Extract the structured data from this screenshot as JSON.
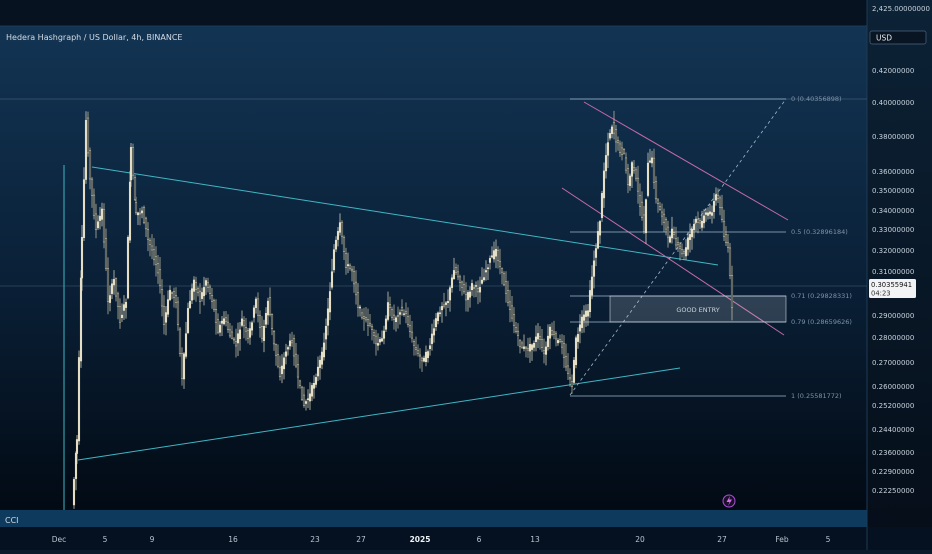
{
  "chart_data": {
    "type": "candlestick",
    "title": "Hedera Hashgraph / US Dollar, 4h, BINANCE",
    "currency": "USD",
    "price_scale": [
      {
        "label": "2,425.00000000",
        "value": 2425
      },
      {
        "label": "0.42000000",
        "value": 0.42
      },
      {
        "label": "0.40000000",
        "value": 0.4
      },
      {
        "label": "0.38000000",
        "value": 0.38
      },
      {
        "label": "0.36000000",
        "value": 0.36
      },
      {
        "label": "0.35000000",
        "value": 0.35
      },
      {
        "label": "0.34000000",
        "value": 0.34
      },
      {
        "label": "0.33000000",
        "value": 0.33
      },
      {
        "label": "0.32000000",
        "value": 0.32
      },
      {
        "label": "0.31000000",
        "value": 0.31
      },
      {
        "label": "0.29000000",
        "value": 0.29
      },
      {
        "label": "0.28000000",
        "value": 0.28
      },
      {
        "label": "0.27000000",
        "value": 0.27
      },
      {
        "label": "0.26000000",
        "value": 0.26
      },
      {
        "label": "0.25200000",
        "value": 0.252
      },
      {
        "label": "0.24400000",
        "value": 0.244
      },
      {
        "label": "0.23600000",
        "value": 0.236
      },
      {
        "label": "0.22900000",
        "value": 0.229
      },
      {
        "label": "0.22250000",
        "value": 0.2225
      }
    ],
    "last_price": "0.30355941",
    "countdown": "04:23",
    "x_ticks": [
      {
        "label": "Dec",
        "bold": false
      },
      {
        "label": "5",
        "bold": false
      },
      {
        "label": "9",
        "bold": false
      },
      {
        "label": "16",
        "bold": false
      },
      {
        "label": "23",
        "bold": false
      },
      {
        "label": "27",
        "bold": false
      },
      {
        "label": "2025",
        "bold": true
      },
      {
        "label": "6",
        "bold": false
      },
      {
        "label": "13",
        "bold": false
      },
      {
        "label": "20",
        "bold": false
      },
      {
        "label": "27",
        "bold": false
      },
      {
        "label": "Feb",
        "bold": false
      },
      {
        "label": "5",
        "bold": false
      }
    ],
    "fib_levels": [
      {
        "label": "0 (0.40356898)",
        "value": 0.40356898
      },
      {
        "label": "0.5 (0.32896184)",
        "value": 0.32896184
      },
      {
        "label": "0.71 (0.29828331)",
        "value": 0.29828331
      },
      {
        "label": "0.79 (0.28659626)",
        "value": 0.28659626
      },
      {
        "label": "1 (0.25581772)",
        "value": 0.25581772
      }
    ],
    "zone_label": "GOOD ENTRY",
    "indicator_label": "CCI",
    "colors": {
      "bull": "#e8e2c8",
      "bear": "#cfc6a6",
      "trendline": "#3fb7c4",
      "channel": "#c56aa8",
      "fib": "#8aa2b6",
      "zone": "#d9dee6",
      "background_top": "#123453",
      "background_bottom": "#020a14"
    }
  }
}
